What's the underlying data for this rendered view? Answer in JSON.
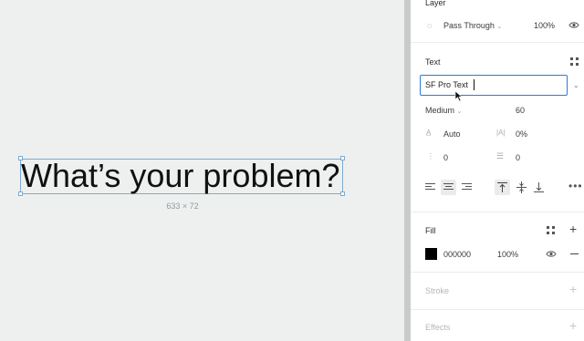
{
  "canvas": {
    "text": "What’s your problem?",
    "dimensions": "633 × 72"
  },
  "layer": {
    "title": "Layer",
    "blend_mode": "Pass Through",
    "opacity": "100%"
  },
  "text": {
    "title": "Text",
    "font_family": "SF Pro Text",
    "font_weight": "Medium",
    "font_size": "60",
    "line_height": "Auto",
    "letter_spacing": "0%",
    "paragraph_spacing": "0",
    "paragraph_indent": "0"
  },
  "fill": {
    "title": "Fill",
    "color_hex": "000000",
    "opacity": "100%",
    "swatch_color": "#000000"
  },
  "stroke": {
    "title": "Stroke"
  },
  "effects": {
    "title": "Effects"
  },
  "colors": {
    "selection": "#7eaacf",
    "input_focus": "#2d7bd8"
  }
}
